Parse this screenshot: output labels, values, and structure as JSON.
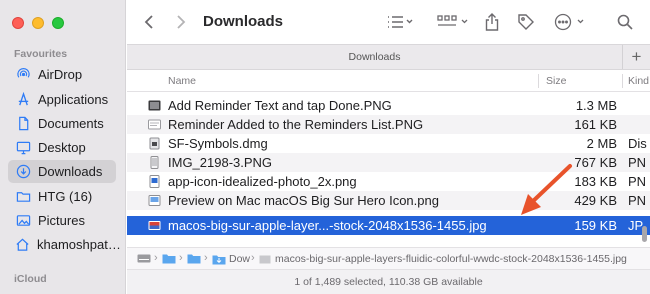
{
  "window": {
    "title": "Downloads"
  },
  "sidebar": {
    "favourites_heading": "Favourites",
    "items": [
      {
        "label": "AirDrop",
        "icon": "airdrop-icon"
      },
      {
        "label": "Applications",
        "icon": "applications-icon"
      },
      {
        "label": "Documents",
        "icon": "document-icon"
      },
      {
        "label": "Desktop",
        "icon": "desktop-icon"
      },
      {
        "label": "Downloads",
        "icon": "downloads-icon",
        "selected": true
      },
      {
        "label": "HTG (16)",
        "icon": "folder-icon"
      },
      {
        "label": "Pictures",
        "icon": "pictures-icon"
      },
      {
        "label": "khamoshpat…",
        "icon": "home-icon"
      }
    ],
    "icloud_heading": "iCloud"
  },
  "toolbar": {
    "back_icon": "chevron-left-icon",
    "forward_icon": "chevron-right-icon",
    "view_icon": "list-view-icon",
    "group_icon": "grid-group-icon",
    "share_icon": "share-icon",
    "tag_icon": "tag-icon",
    "more_icon": "ellipsis-circle-icon",
    "search_icon": "search-icon"
  },
  "tabbar": {
    "label": "Downloads",
    "add_label": "+"
  },
  "columns": {
    "name": "Name",
    "size": "Size",
    "kind": "Kind"
  },
  "files": [
    {
      "name": "Add Reminder Text and tap Done.PNG",
      "size": "1.3 MB",
      "kind": ""
    },
    {
      "name": "Reminder Added to the Reminders List.PNG",
      "size": "161 KB",
      "kind": ""
    },
    {
      "name": "SF-Symbols.dmg",
      "size": "2 MB",
      "kind": "Dis"
    },
    {
      "name": "IMG_2198-3.PNG",
      "size": "767 KB",
      "kind": "PN"
    },
    {
      "name": "app-icon-idealized-photo_2x.png",
      "size": "183 KB",
      "kind": "PN"
    },
    {
      "name": "Preview on Mac macOS Big Sur Hero Icon.png",
      "size": "429 KB",
      "kind": "PN"
    },
    {
      "name": "macos-big-sur-apple-layer...-stock-2048x1536-1455.jpg",
      "size": "159 KB",
      "kind": "JP",
      "selected": true
    }
  ],
  "pathbar": {
    "segments": [
      "Dow"
    ],
    "file": "macos-big-sur-apple-layers-fluidic-colorful-wwdc-stock-2048x1536-1455.jpg"
  },
  "status": {
    "text": "1 of 1,489 selected, 110.38 GB available"
  },
  "colors": {
    "accent": "#2463d9",
    "sidebar_bg": "#e8e6e9",
    "arrow": "#e8532b"
  }
}
